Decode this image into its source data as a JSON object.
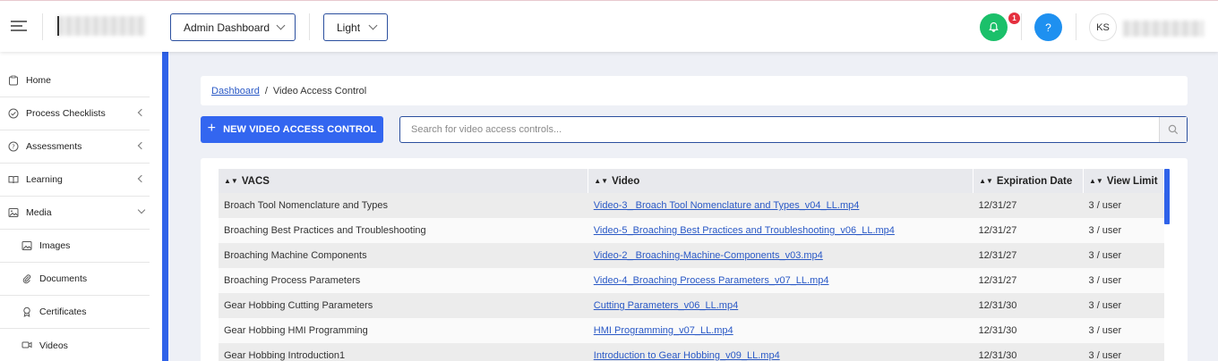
{
  "header": {
    "dashboard_select": "Admin Dashboard",
    "theme_select": "Light",
    "notification_count": "1",
    "help_label": "?",
    "user_initials": "KS"
  },
  "sidebar": {
    "items": [
      {
        "label": "Home"
      },
      {
        "label": "Process Checklists"
      },
      {
        "label": "Assessments"
      },
      {
        "label": "Learning"
      },
      {
        "label": "Media"
      },
      {
        "label": "Images"
      },
      {
        "label": "Documents"
      },
      {
        "label": "Certificates"
      },
      {
        "label": "Videos"
      }
    ]
  },
  "breadcrumb": {
    "parent": "Dashboard",
    "separator": "/",
    "current": "Video Access Control"
  },
  "toolbar": {
    "new_button": "NEW VIDEO ACCESS CONTROL",
    "search_placeholder": "Search for video access controls..."
  },
  "table": {
    "columns": [
      "VACS",
      "Video",
      "Expiration Date",
      "View Limit"
    ],
    "rows": [
      {
        "vacs": "Broach Tool Nomenclature and Types",
        "video": "Video-3_ Broach Tool Nomenclature and Types_v04_LL.mp4",
        "expiration": "12/31/27",
        "limit": "3 / user"
      },
      {
        "vacs": "Broaching Best Practices and Troubleshooting",
        "video": "Video-5_Broaching Best Practices and Troubleshooting_v06_LL.mp4",
        "expiration": "12/31/27",
        "limit": "3 / user"
      },
      {
        "vacs": "Broaching Machine Components",
        "video": "Video-2_ Broaching-Machine-Components_v03.mp4",
        "expiration": "12/31/27",
        "limit": "3 / user"
      },
      {
        "vacs": "Broaching Process Parameters",
        "video": "Video-4_Broaching Process Parameters_v07_LL.mp4",
        "expiration": "12/31/27",
        "limit": "3 / user"
      },
      {
        "vacs": "Gear Hobbing Cutting Parameters",
        "video": "Cutting Parameters_v06_LL.mp4",
        "expiration": "12/31/30",
        "limit": "3 / user"
      },
      {
        "vacs": "Gear Hobbing HMI Programming",
        "video": "HMI Programming_v07_LL.mp4",
        "expiration": "12/31/30",
        "limit": "3 / user"
      },
      {
        "vacs": "Gear Hobbing Introduction1",
        "video": "Introduction to Gear Hobbing_v09_LL.mp4",
        "expiration": "12/31/30",
        "limit": "3 / user"
      }
    ]
  },
  "colors": {
    "accent": "#2f62e9",
    "primary_button": "#3366f0",
    "notification": "#1bc06a",
    "help": "#1e90f0",
    "badge": "#e5303f",
    "link": "#2a59c6"
  },
  "icons": {
    "menu": "hamburger-icon",
    "notifications": "bell-icon",
    "help": "question-icon",
    "search": "search-icon"
  }
}
